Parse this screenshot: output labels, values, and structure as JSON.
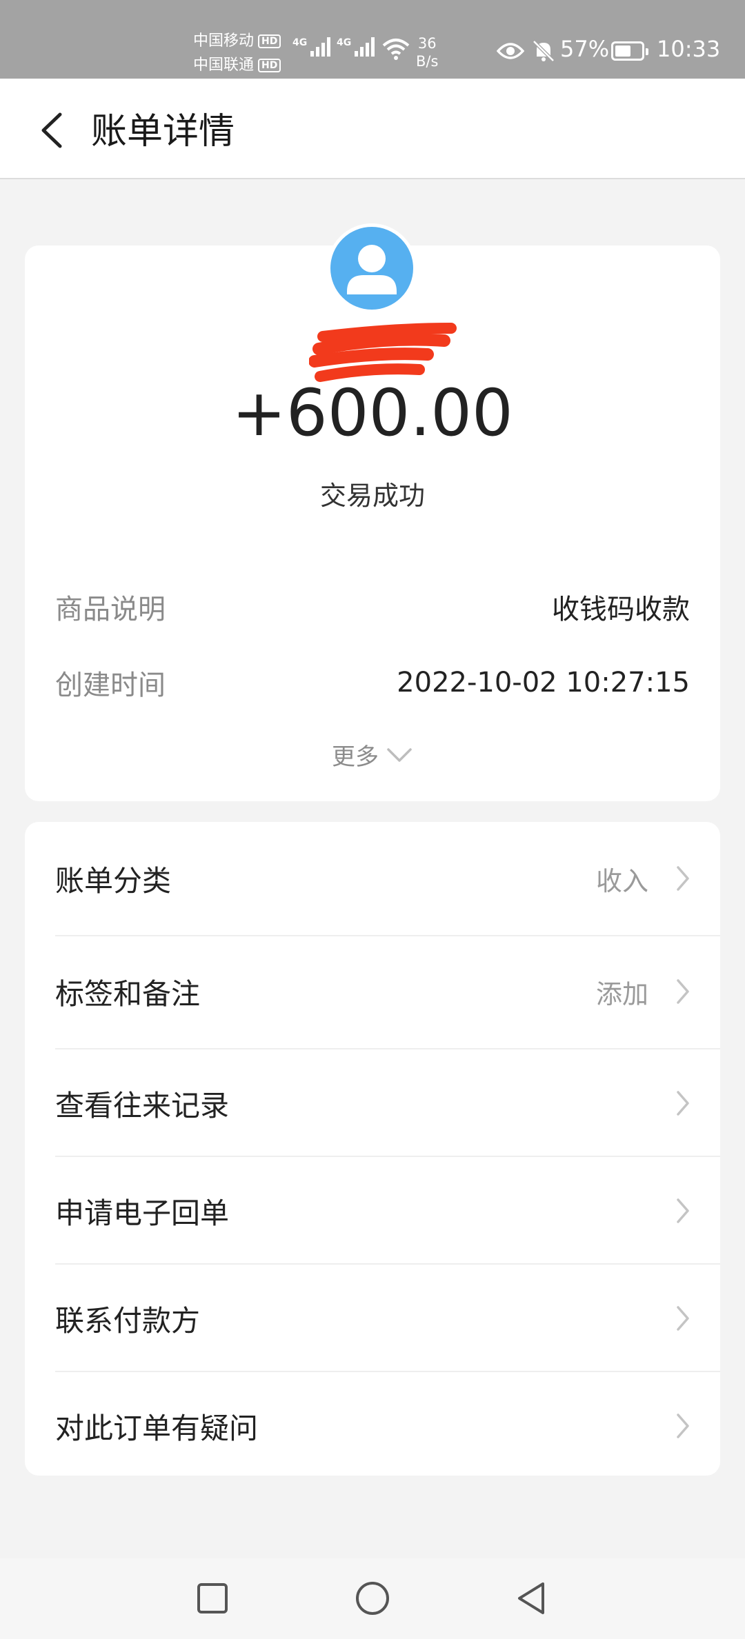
{
  "status_bar": {
    "carrier1": "中国移动",
    "carrier2": "中国联通",
    "hd": "HD",
    "net1": "4G",
    "net2": "4G",
    "speed_value": "36",
    "speed_unit": "B/s",
    "battery": "57%",
    "battery_level": 0.57,
    "time": "10:33"
  },
  "header": {
    "title": "账单详情"
  },
  "transaction": {
    "amount": "+600.00",
    "status": "交易成功",
    "details": [
      {
        "label": "商品说明",
        "value": "收钱码收款"
      },
      {
        "label": "创建时间",
        "value": "2022-10-02 10:27:15"
      }
    ],
    "more_label": "更多"
  },
  "actions": [
    {
      "label": "账单分类",
      "value": "收入"
    },
    {
      "label": "标签和备注",
      "value": "添加"
    },
    {
      "label": "查看往来记录",
      "value": ""
    },
    {
      "label": "申请电子回单",
      "value": ""
    },
    {
      "label": "联系付款方",
      "value": ""
    },
    {
      "label": "对此订单有疑问",
      "value": ""
    }
  ],
  "colors": {
    "status_bar_bg": "#a3a3a3",
    "avatar_bg": "#56b0f0",
    "redaction": "#f23a1c",
    "page_bg": "#f3f3f3"
  },
  "icons": {
    "back": "chevron-left-icon",
    "avatar": "user-avatar-icon",
    "more": "chevron-down-icon",
    "row": "chevron-right-icon",
    "nav_recent": "square-icon",
    "nav_home": "circle-icon",
    "nav_back": "triangle-back-icon"
  }
}
